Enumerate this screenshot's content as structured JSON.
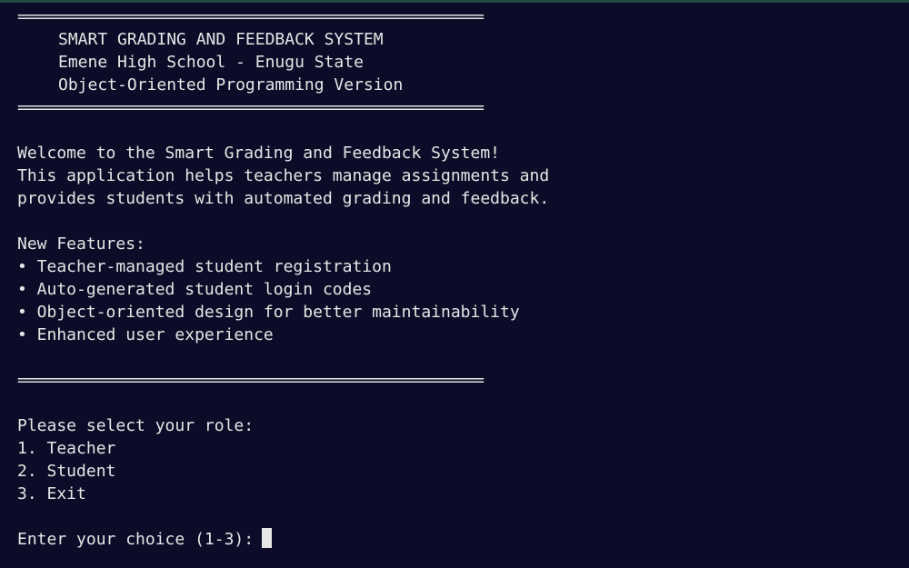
{
  "separator": "============================================================",
  "header": {
    "title": "SMART GRADING AND FEEDBACK SYSTEM",
    "school": "Emene High School - Enugu State",
    "version": "Object-Oriented Programming Version"
  },
  "welcome": {
    "line1": "Welcome to the Smart Grading and Feedback System!",
    "line2": "This application helps teachers manage assignments and",
    "line3": "provides students with automated grading and feedback."
  },
  "features": {
    "heading": "New Features:",
    "items": [
      "• Teacher-managed student registration",
      "• Auto-generated student login codes",
      "• Object-oriented design for better maintainability",
      "• Enhanced user experience"
    ]
  },
  "menu": {
    "prompt": "Please select your role:",
    "options": [
      "1. Teacher",
      "2. Student",
      "3. Exit"
    ]
  },
  "input": {
    "prompt": "Enter your choice (1-3):",
    "value": ""
  }
}
